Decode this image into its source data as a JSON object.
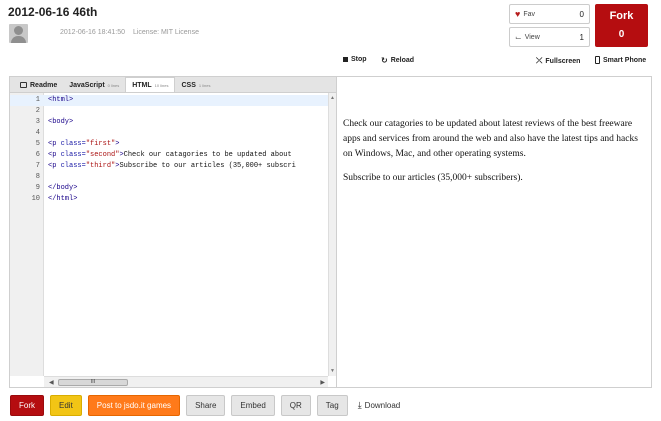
{
  "header": {
    "title": "2012-06-16 46th",
    "date": "2012-06-16 18:41:50",
    "license": "License: MIT License"
  },
  "stats": {
    "fav_label": "Fav",
    "fav_count": "0",
    "view_label": "View",
    "view_count": "1",
    "fork_label": "Fork",
    "fork_count": "0"
  },
  "preview_toolbar": {
    "stop": "Stop",
    "reload": "Reload",
    "fullscreen": "Fullscreen",
    "smartphone": "Smart Phone"
  },
  "tabs": [
    {
      "label": "Readme",
      "count": ""
    },
    {
      "label": "JavaScript",
      "count": "0 lines"
    },
    {
      "label": "HTML",
      "count": "10 lines",
      "active": true
    },
    {
      "label": "CSS",
      "count": "1 lines"
    }
  ],
  "editor": {
    "line_numbers": [
      "1",
      "2",
      "3",
      "4",
      "5",
      "6",
      "7",
      "8",
      "9",
      "10"
    ],
    "lines": [
      {
        "parts": [
          {
            "t": "tag",
            "v": "<html>"
          }
        ]
      },
      {
        "parts": []
      },
      {
        "parts": [
          {
            "t": "tag",
            "v": "<body>"
          }
        ]
      },
      {
        "parts": []
      },
      {
        "parts": [
          {
            "t": "tag",
            "v": "<p "
          },
          {
            "t": "attr",
            "v": "class="
          },
          {
            "t": "str",
            "v": "\"first\""
          },
          {
            "t": "tag",
            "v": ">"
          }
        ]
      },
      {
        "parts": [
          {
            "t": "tag",
            "v": "<p "
          },
          {
            "t": "attr",
            "v": "class="
          },
          {
            "t": "str",
            "v": "\"second\""
          },
          {
            "t": "tag",
            "v": ">"
          },
          {
            "t": "txt",
            "v": "Check our catagories to be updated about"
          }
        ]
      },
      {
        "parts": [
          {
            "t": "tag",
            "v": "<p "
          },
          {
            "t": "attr",
            "v": "class="
          },
          {
            "t": "str",
            "v": "\"third\""
          },
          {
            "t": "tag",
            "v": ">"
          },
          {
            "t": "txt",
            "v": "Subscribe to our articles (35,000+ subscri"
          }
        ]
      },
      {
        "parts": []
      },
      {
        "parts": [
          {
            "t": "tag",
            "v": "</body>"
          }
        ]
      },
      {
        "parts": [
          {
            "t": "tag",
            "v": "</html>"
          }
        ]
      }
    ],
    "current_line": 1,
    "hscroll_grip": "III"
  },
  "preview": {
    "paragraphs": [
      "Check our catagories to be updated about latest reviews of the best freeware apps and services from around the web and also have the latest tips and hacks on Windows, Mac, and other operating systems.",
      "Subscribe to our articles (35,000+ subscribers)."
    ]
  },
  "actions": {
    "fork": "Fork",
    "edit": "Edit",
    "post": "Post to jsdo.it games",
    "share": "Share",
    "embed": "Embed",
    "qr": "QR",
    "tag": "Tag",
    "download": "Download"
  }
}
